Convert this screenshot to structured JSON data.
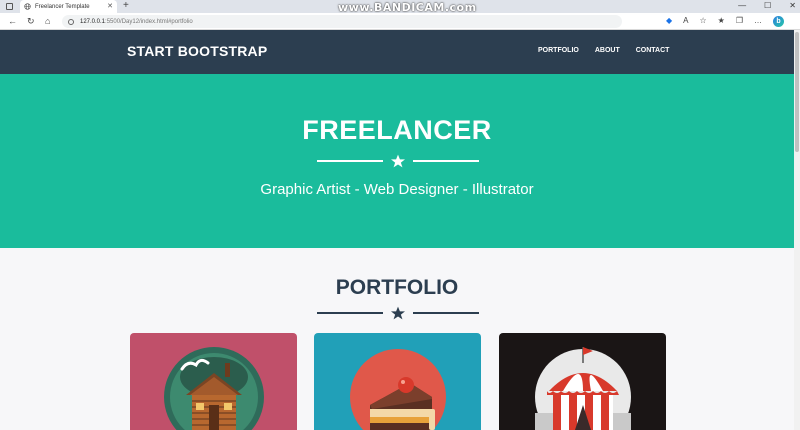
{
  "browser": {
    "tab_title": "Freelancer Template",
    "url_host": "127.0.0.1",
    "url_path": ":5500/Day12/index.html#portfolio",
    "watermark": "www.BANDICAM.com",
    "icons": [
      "sidebar-icon",
      "globe-icon",
      "close-icon",
      "new-tab-icon",
      "back-icon",
      "refresh-icon",
      "home-icon",
      "info-icon",
      "tag-icon",
      "read-aloud-icon",
      "favorite-icon",
      "favorites-icon",
      "collections-icon",
      "more-icon",
      "bing-icon",
      "minimize-icon",
      "maximize-icon",
      "window-close-icon"
    ]
  },
  "navbar": {
    "brand": "START BOOTSTRAP",
    "links": [
      "PORTFOLIO",
      "ABOUT",
      "CONTACT"
    ]
  },
  "hero": {
    "title": "FREELANCER",
    "subtitle": "Graphic Artist - Web Designer - Illustrator"
  },
  "portfolio": {
    "title": "PORTFOLIO",
    "cards": [
      {
        "subject": "cabin",
        "background": "#c0506a"
      },
      {
        "subject": "cake",
        "background": "#21a0b8"
      },
      {
        "subject": "circus tent",
        "background": "#1a1515"
      }
    ]
  },
  "colors": {
    "navbar": "#2c3e50",
    "hero": "#1abc9c",
    "text_dark": "#2c3e50",
    "white": "#ffffff"
  }
}
